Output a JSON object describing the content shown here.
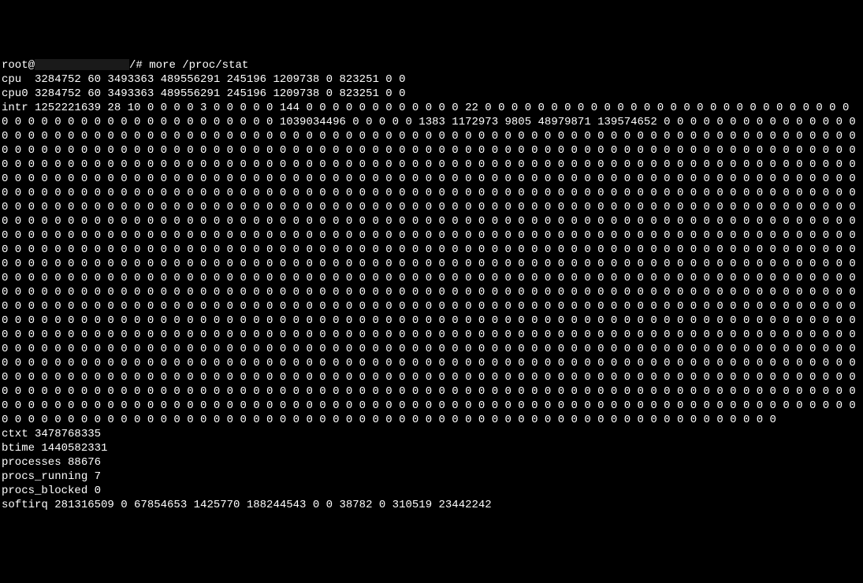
{
  "prompt": {
    "user": "root@",
    "path": "/#",
    "command": "more /proc/stat"
  },
  "output": {
    "cpu_line": "cpu  3284752 60 3493363 489556291 245196 1209738 0 823251 0 0",
    "cpu0_line": "cpu0 3284752 60 3493363 489556291 245196 1209738 0 823251 0 0",
    "intr_line": "intr 1252221639 28 10 0 0 0 0 3 0 0 0 0 0 144 0 0 0 0 0 0 0 0 0 0 0 0 22 0 0 0 0 0 0 0 0 0 0 0 0 0 0 0 0 0 0 0 0 0 0 0 0 0 0 0 0 0 0 0 0 0 0 0 0 0 0 0 0 0 0 0 0 0 0 0 0 0 1039034496 0 0 0 0 0 1383 1172973 9805 48979871 139574652 0 0 0 0 0 0 0 0 0 0 0 0 0 0 0 0 0 0 0 0 0 0 0 0 0 0 0 0 0 0 0 0 0 0 0 0 0 0 0 0 0 0 0 0 0 0 0 0 0 0 0 0 0 0 0 0 0 0 0 0 0 0 0 0 0 0 0 0 0 0 0 0 0 0 0 0 0 0 0 0 0 0 0 0 0 0 0 0 0 0 0 0 0 0 0 0 0 0 0 0 0 0 0 0 0 0 0 0 0 0 0 0 0 0 0 0 0 0 0 0 0 0 0 0 0 0 0 0 0 0 0 0 0 0 0 0 0 0 0 0 0 0 0 0 0 0 0 0 0 0 0 0 0 0 0 0 0 0 0 0 0 0 0 0 0 0 0 0 0 0 0 0 0 0 0 0 0 0 0 0 0 0 0 0 0 0 0 0 0 0 0 0 0 0 0 0 0 0 0 0 0 0 0 0 0 0 0 0 0 0 0 0 0 0 0 0 0 0 0 0 0 0 0 0 0 0 0 0 0 0 0 0 0 0 0 0 0 0 0 0 0 0 0 0 0 0 0 0 0 0 0 0 0 0 0 0 0 0 0 0 0 0 0 0 0 0 0 0 0 0 0 0 0 0 0 0 0 0 0 0 0 0 0 0 0 0 0 0 0 0 0 0 0 0 0 0 0 0 0 0 0 0 0 0 0 0 0 0 0 0 0 0 0 0 0 0 0 0 0 0 0 0 0 0 0 0 0 0 0 0 0 0 0 0 0 0 0 0 0 0 0 0 0 0 0 0 0 0 0 0 0 0 0 0 0 0 0 0 0 0 0 0 0 0 0 0 0 0 0 0 0 0 0 0 0 0 0 0 0 0 0 0 0 0 0 0 0 0 0 0 0 0 0 0 0 0 0 0 0 0 0 0 0 0 0 0 0 0 0 0 0 0 0 0 0 0 0 0 0 0 0 0 0 0 0 0 0 0 0 0 0 0 0 0 0 0 0 0 0 0 0 0 0 0 0 0 0 0 0 0 0 0 0 0 0 0 0 0 0 0 0 0 0 0 0 0 0 0 0 0 0 0 0 0 0 0 0 0 0 0 0 0 0 0 0 0 0 0 0 0 0 0 0 0 0 0 0 0 0 0 0 0 0 0 0 0 0 0 0 0 0 0 0 0 0 0 0 0 0 0 0 0 0 0 0 0 0 0 0 0 0 0 0 0 0 0 0 0 0 0 0 0 0 0 0 0 0 0 0 0 0 0 0 0 0 0 0 0 0 0 0 0 0 0 0 0 0 0 0 0 0 0 0 0 0 0 0 0 0 0 0 0 0 0 0 0 0 0 0 0 0 0 0 0 0 0 0 0 0 0 0 0 0 0 0 0 0 0 0 0 0 0 0 0 0 0 0 0 0 0 0 0 0 0 0 0 0 0 0 0 0 0 0 0 0 0 0 0 0 0 0 0 0 0 0 0 0 0 0 0 0 0 0 0 0 0 0 0 0 0 0 0 0 0 0 0 0 0 0 0 0 0 0 0 0 0 0 0 0 0 0 0 0 0 0 0 0 0 0 0 0 0 0 0 0 0 0 0 0 0 0 0 0 0 0 0 0 0 0 0 0 0 0 0 0 0 0 0 0 0 0 0 0 0 0 0 0 0 0 0 0 0 0 0 0 0 0 0 0 0 0 0 0 0 0 0 0 0 0 0 0 0 0 0 0 0 0 0 0 0 0 0 0 0 0 0 0 0 0 0 0 0 0 0 0 0 0 0 0 0 0 0 0 0 0 0 0 0 0 0 0 0 0 0 0 0 0 0 0 0 0 0 0 0 0 0 0 0 0 0 0 0 0 0 0 0 0 0 0 0 0 0 0 0 0 0 0 0 0 0 0 0 0 0 0 0 0 0 0 0 0 0 0 0 0 0 0 0 0 0 0 0 0 0 0 0 0 0 0 0 0 0 0 0 0 0 0 0 0 0 0 0 0 0 0 0 0 0 0 0 0 0 0 0 0 0 0 0 0 0 0 0 0 0 0 0 0 0 0 0 0 0 0 0 0 0 0 0 0 0 0 0 0 0 0 0 0 0 0 0 0 0 0 0 0 0 0 0 0 0 0 0 0 0 0 0 0 0 0 0 0 0 0 0 0 0 0 0 0 0 0 0 0 0 0 0 0 0 0 0 0 0 0 0 0 0 0 0 0 0 0 0 0 0 0 0 0 0 0 0 0 0 0 0 0 0 0 0 0 0 0 0 0 0 0 0 0 0 0 0 0 0 0 0 0 0 0 0 0 0 0 0 0 0 0 0 0 0 0 0 0 0 0 0 0 0 0 0 0 0 0 0 0 0 0 0 0 0 0 0 0 0 0 0 0 0 0 0 0 0 0 0 0 0 0 0 0 0 0 0 0 0 0 0 0 0 0 0 0 0 0 0 0 0 0 0 0 0 0 0 0 0 0 0 0 0 0 0 0 0 0 0 0 0 0 0 0 0 0 0 0 0 0 0 0 0 0 0 0 0 0 0 0 0 0 0 0 0 0 0 0 0 0 0 0 0 0 0 0 0 0 0 0 0 0 0 0 0 0 0 0 0 0 0 0 0 0 0 0 0 0 0 0 0 0 0 0 0 0 0 0 0 0 0 0 0 0 0 0 0 0 0 0 0 0 0 0 0 0 0 0 0 0 0 0 0 0 0 0 0 0 0 0 0 0 0 0 0 0 0 0 0 0 0 0 0 0 0 0 0 0 0 0 0 0 0 0 0 0 0 0 0 0 0 0 0 0 0 0 0 0 0 0 0 0 0 0 0 0 0 0 0 0 0 0 0 0 0 0 0 0 0 0 0 0 0 0 0 0 0 0 0 0 0 0 0 0 0 0 0 0 0 0 0 0 0 0 0 0 0 0 0 0 0 0 0 0 0 0 0 0 0 0 0 0 0 0 0 0 0 0 0 0 0 0 0 0 0 0 0 0 0 0 0 0 0 0 0 0 0 0 0 0 0 0 0 0 0 0 0 0 0 0 0 0 0 0 0 0 0 0 0 0 0 0 0 0 0 0 0 0 0 0 0 0 0 0 0 0 0 0 0 0 0 0 0 0 0 0 0 0 0 0 0",
    "ctxt_line": "ctxt 3478768335",
    "btime_line": "btime 1440582331",
    "processes_line": "processes 88676",
    "procs_running_line": "procs_running 7",
    "procs_blocked_line": "procs_blocked 0",
    "softirq_line": "softirq 281316509 0 67854653 1425770 188244543 0 0 38782 0 310519 23442242"
  }
}
